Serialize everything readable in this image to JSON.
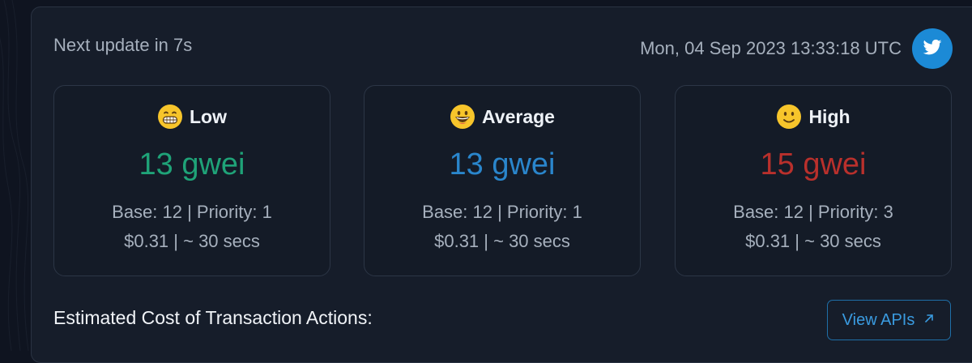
{
  "header": {
    "next_update": "Next update in 7s",
    "timestamp": "Mon, 04 Sep 2023 13:33:18 UTC",
    "twitter_icon": "twitter-icon",
    "twitter_color": "#1c8ad6"
  },
  "cards": [
    {
      "emoji": "grinning-teeth-emoji",
      "title": "Low",
      "price": "13 gwei",
      "price_color": "#1fa378",
      "base_priority": "Base: 12 | Priority: 1",
      "cost_time": "$0.31 | ~ 30 secs"
    },
    {
      "emoji": "grinning-emoji",
      "title": "Average",
      "price": "13 gwei",
      "price_color": "#2a86cc",
      "base_priority": "Base: 12 | Priority: 1",
      "cost_time": "$0.31 | ~ 30 secs"
    },
    {
      "emoji": "slight-smile-emoji",
      "title": "High",
      "price": "15 gwei",
      "price_color": "#b9302c",
      "base_priority": "Base: 12 | Priority: 3",
      "cost_time": "$0.31 | ~ 30 secs"
    }
  ],
  "actions": {
    "section_title": "Estimated Cost of Transaction Actions:",
    "view_apis_label": "View APIs",
    "view_apis_icon": "external-arrow-icon"
  }
}
